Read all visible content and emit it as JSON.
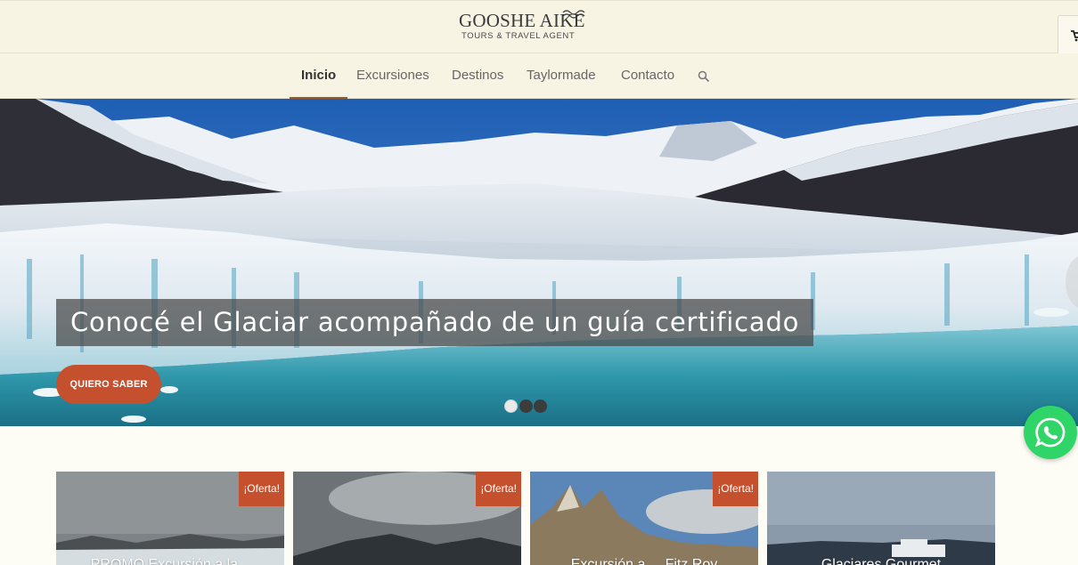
{
  "header": {
    "logo": {
      "name": "GOOSHE AIKE",
      "tagline": "TOURS & TRAVEL AGENT"
    },
    "cart_icon": "cart-icon"
  },
  "nav": {
    "items": [
      {
        "label": "Inicio",
        "active": true
      },
      {
        "label": "Excursiones",
        "active": false
      },
      {
        "label": "Destinos",
        "active": false
      },
      {
        "label": "Taylormade",
        "active": false
      },
      {
        "label": "Contacto",
        "active": false
      }
    ],
    "search_icon": "search-icon"
  },
  "hero": {
    "caption": "Conocé el Glaciar acompañado de un guía certificado",
    "button_label": "QUIERO SABER",
    "slides_total": 3,
    "active_slide": 1
  },
  "whatsapp": {
    "icon": "whatsapp-icon",
    "color": "#2fd567"
  },
  "products": [
    {
      "badge": "¡Oferta!",
      "title": "PROMO Excursión a la..."
    },
    {
      "badge": "¡Oferta!",
      "title": ""
    },
    {
      "badge": "¡Oferta!",
      "title": "Excursión a ... Fitz Roy"
    },
    {
      "badge": "",
      "title": "Glaciares Gourmet"
    }
  ],
  "colors": {
    "header_bg": "#f7f4e4",
    "accent": "#c4502e",
    "nav_active_underline": "#9a5a2e"
  }
}
